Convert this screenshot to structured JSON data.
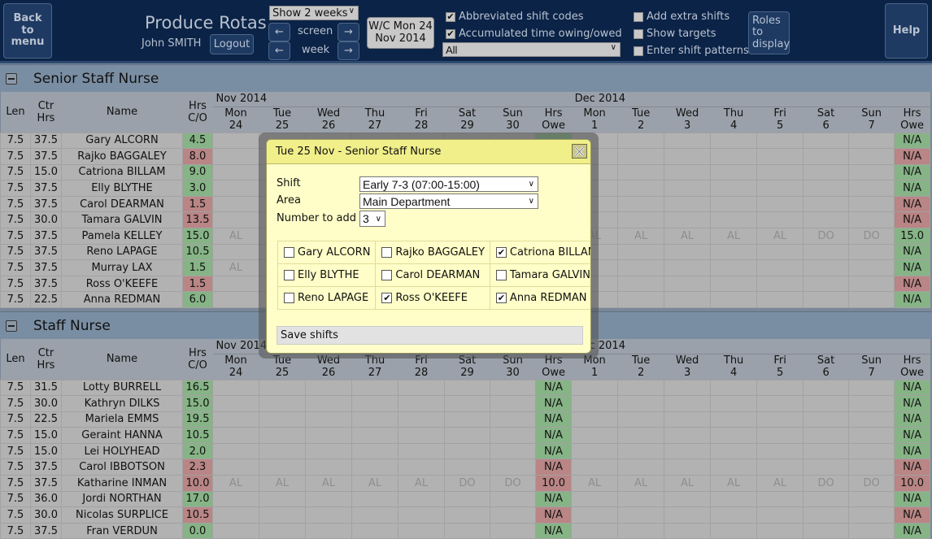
{
  "header": {
    "back_label": "Back to menu",
    "title": "Produce Rotas",
    "user": "John SMITH",
    "logout_label": "Logout",
    "show_weeks": "Show 2 weeks",
    "screen_label": "screen",
    "week_label": "week",
    "prev_arrow": "←",
    "next_arrow": "→",
    "wc_line1": "W/C Mon 24",
    "wc_line2": "Nov 2014",
    "options": [
      {
        "label": "Abbreviated shift codes",
        "checked": true
      },
      {
        "label": "Accumulated time owing/owed",
        "checked": true
      },
      {
        "label": "Add extra shifts",
        "checked": false
      },
      {
        "label": "Show targets",
        "checked": false
      },
      {
        "label": "Enter shift patterns",
        "checked": false
      }
    ],
    "filter_select": "All",
    "roles_label": "Roles to display",
    "help_label": "Help"
  },
  "columns": {
    "len": "Len",
    "ctr_hrs": "Ctr Hrs",
    "name": "Name",
    "hrs_co": "Hrs C/O",
    "month1": "Nov 2014",
    "month2": "Dec 2014",
    "days": [
      {
        "d": "Mon",
        "n": "24"
      },
      {
        "d": "Tue",
        "n": "25"
      },
      {
        "d": "Wed",
        "n": "26"
      },
      {
        "d": "Thu",
        "n": "27"
      },
      {
        "d": "Fri",
        "n": "28"
      },
      {
        "d": "Sat",
        "n": "29"
      },
      {
        "d": "Sun",
        "n": "30"
      },
      {
        "d": "Hrs",
        "n": "Owe"
      },
      {
        "d": "Mon",
        "n": "1"
      },
      {
        "d": "Tue",
        "n": "2"
      },
      {
        "d": "Wed",
        "n": "3"
      },
      {
        "d": "Thu",
        "n": "4"
      },
      {
        "d": "Fri",
        "n": "5"
      },
      {
        "d": "Sat",
        "n": "6"
      },
      {
        "d": "Sun",
        "n": "7"
      },
      {
        "d": "Hrs",
        "n": "Owe"
      }
    ]
  },
  "colors": {
    "positive": "#86b486",
    "negative": "#b98585",
    "header_bg": "#0b2347",
    "modal_bg": "#fffec8"
  },
  "sections": [
    {
      "title": "Senior Staff Nurse",
      "rows": [
        {
          "len": "7.5",
          "ctr": "37.5",
          "name": "Gary ALCORN",
          "co": "4.5",
          "co_status": "green",
          "w1": [
            "",
            "",
            "",
            "",
            "",
            "",
            ""
          ],
          "owe1": "",
          "owe1_status": "green",
          "w2": [
            "",
            "",
            "",
            "",
            "",
            "",
            ""
          ],
          "owe2": "N/A",
          "owe2_status": "green"
        },
        {
          "len": "7.5",
          "ctr": "37.5",
          "name": "Rajko BAGGALEY",
          "co": "8.0",
          "co_status": "red",
          "w1": [
            "",
            "",
            "",
            "",
            "",
            "",
            ""
          ],
          "owe1": "",
          "owe1_status": "red",
          "w2": [
            "",
            "",
            "",
            "",
            "",
            "",
            ""
          ],
          "owe2": "N/A",
          "owe2_status": "red"
        },
        {
          "len": "7.5",
          "ctr": "15.0",
          "name": "Catriona BILLAM",
          "co": "9.0",
          "co_status": "green",
          "w1": [
            "",
            "",
            "",
            "",
            "",
            "",
            ""
          ],
          "owe1": "",
          "owe1_status": "green",
          "w2": [
            "",
            "",
            "",
            "",
            "",
            "",
            ""
          ],
          "owe2": "N/A",
          "owe2_status": "green"
        },
        {
          "len": "7.5",
          "ctr": "37.5",
          "name": "Elly BLYTHE",
          "co": "3.0",
          "co_status": "green",
          "w1": [
            "",
            "",
            "",
            "",
            "",
            "",
            ""
          ],
          "owe1": "",
          "owe1_status": "green",
          "w2": [
            "",
            "",
            "",
            "",
            "",
            "",
            ""
          ],
          "owe2": "N/A",
          "owe2_status": "green"
        },
        {
          "len": "7.5",
          "ctr": "37.5",
          "name": "Carol DEARMAN",
          "co": "1.5",
          "co_status": "red",
          "w1": [
            "",
            "",
            "",
            "",
            "",
            "",
            ""
          ],
          "owe1": "",
          "owe1_status": "red",
          "w2": [
            "",
            "",
            "",
            "",
            "",
            "",
            ""
          ],
          "owe2": "N/A",
          "owe2_status": "red"
        },
        {
          "len": "7.5",
          "ctr": "30.0",
          "name": "Tamara GALVIN",
          "co": "13.5",
          "co_status": "red",
          "w1": [
            "",
            "",
            "",
            "",
            "",
            "",
            ""
          ],
          "owe1": "",
          "owe1_status": "red",
          "w2": [
            "",
            "",
            "",
            "",
            "",
            "",
            ""
          ],
          "owe2": "N/A",
          "owe2_status": "red"
        },
        {
          "len": "7.5",
          "ctr": "37.5",
          "name": "Pamela KELLEY",
          "co": "15.0",
          "co_status": "green",
          "w1": [
            "AL",
            "",
            "",
            "",
            "",
            "",
            ""
          ],
          "owe1": "",
          "owe1_status": "green",
          "w2": [
            "AL",
            "AL",
            "AL",
            "AL",
            "AL",
            "DO",
            "DO"
          ],
          "owe2": "15.0",
          "owe2_status": "green"
        },
        {
          "len": "7.5",
          "ctr": "37.5",
          "name": "Reno LAPAGE",
          "co": "10.5",
          "co_status": "green",
          "w1": [
            "",
            "",
            "",
            "",
            "",
            "",
            ""
          ],
          "owe1": "",
          "owe1_status": "green",
          "w2": [
            "",
            "",
            "",
            "",
            "",
            "",
            ""
          ],
          "owe2": "N/A",
          "owe2_status": "green"
        },
        {
          "len": "7.5",
          "ctr": "37.5",
          "name": "Murray LAX",
          "co": "1.5",
          "co_status": "green",
          "w1": [
            "AL",
            "",
            "",
            "",
            "",
            "",
            ""
          ],
          "owe1": "",
          "owe1_status": "green",
          "w2": [
            "",
            "",
            "",
            "",
            "",
            "",
            ""
          ],
          "owe2": "N/A",
          "owe2_status": "green"
        },
        {
          "len": "7.5",
          "ctr": "37.5",
          "name": "Ross O'KEEFE",
          "co": "1.5",
          "co_status": "red",
          "w1": [
            "",
            "",
            "",
            "",
            "",
            "",
            ""
          ],
          "owe1": "",
          "owe1_status": "red",
          "w2": [
            "",
            "",
            "",
            "",
            "",
            "",
            ""
          ],
          "owe2": "N/A",
          "owe2_status": "red"
        },
        {
          "len": "7.5",
          "ctr": "22.5",
          "name": "Anna REDMAN",
          "co": "6.0",
          "co_status": "green",
          "w1": [
            "",
            "",
            "",
            "",
            "",
            "",
            ""
          ],
          "owe1": "",
          "owe1_status": "green",
          "w2": [
            "",
            "",
            "",
            "",
            "",
            "",
            ""
          ],
          "owe2": "N/A",
          "owe2_status": "green"
        }
      ]
    },
    {
      "title": "Staff Nurse",
      "rows": [
        {
          "len": "7.5",
          "ctr": "31.5",
          "name": "Lotty BURRELL",
          "co": "16.5",
          "co_status": "green",
          "w1": [
            "",
            "",
            "",
            "",
            "",
            "",
            ""
          ],
          "owe1": "N/A",
          "owe1_status": "green",
          "w2": [
            "",
            "",
            "",
            "",
            "",
            "",
            ""
          ],
          "owe2": "N/A",
          "owe2_status": "green"
        },
        {
          "len": "7.5",
          "ctr": "30.0",
          "name": "Kathryn DILKS",
          "co": "15.0",
          "co_status": "green",
          "w1": [
            "",
            "",
            "",
            "",
            "",
            "",
            ""
          ],
          "owe1": "N/A",
          "owe1_status": "green",
          "w2": [
            "",
            "",
            "",
            "",
            "",
            "",
            ""
          ],
          "owe2": "N/A",
          "owe2_status": "green"
        },
        {
          "len": "7.5",
          "ctr": "22.5",
          "name": "Mariela EMMS",
          "co": "19.5",
          "co_status": "green",
          "w1": [
            "",
            "",
            "",
            "",
            "",
            "",
            ""
          ],
          "owe1": "N/A",
          "owe1_status": "green",
          "w2": [
            "",
            "",
            "",
            "",
            "",
            "",
            ""
          ],
          "owe2": "N/A",
          "owe2_status": "green"
        },
        {
          "len": "7.5",
          "ctr": "15.0",
          "name": "Geraint HANNA",
          "co": "10.5",
          "co_status": "green",
          "w1": [
            "",
            "",
            "",
            "",
            "",
            "",
            ""
          ],
          "owe1": "N/A",
          "owe1_status": "green",
          "w2": [
            "",
            "",
            "",
            "",
            "",
            "",
            ""
          ],
          "owe2": "N/A",
          "owe2_status": "green"
        },
        {
          "len": "7.5",
          "ctr": "15.0",
          "name": "Lei HOLYHEAD",
          "co": "2.0",
          "co_status": "green",
          "w1": [
            "",
            "",
            "",
            "",
            "",
            "",
            ""
          ],
          "owe1": "N/A",
          "owe1_status": "green",
          "w2": [
            "",
            "",
            "",
            "",
            "",
            "",
            ""
          ],
          "owe2": "N/A",
          "owe2_status": "green"
        },
        {
          "len": "7.5",
          "ctr": "37.5",
          "name": "Carol IBBOTSON",
          "co": "2.3",
          "co_status": "red",
          "w1": [
            "",
            "",
            "",
            "",
            "",
            "",
            ""
          ],
          "owe1": "N/A",
          "owe1_status": "red",
          "w2": [
            "",
            "",
            "",
            "",
            "",
            "",
            ""
          ],
          "owe2": "N/A",
          "owe2_status": "red"
        },
        {
          "len": "7.5",
          "ctr": "37.5",
          "name": "Katharine INMAN",
          "co": "10.0",
          "co_status": "red",
          "w1": [
            "AL",
            "AL",
            "AL",
            "AL",
            "AL",
            "DO",
            "DO"
          ],
          "owe1": "10.0",
          "owe1_status": "red",
          "w2": [
            "AL",
            "AL",
            "AL",
            "AL",
            "AL",
            "DO",
            "DO"
          ],
          "owe2": "10.0",
          "owe2_status": "red"
        },
        {
          "len": "7.5",
          "ctr": "36.0",
          "name": "Jordi NORTHAN",
          "co": "17.0",
          "co_status": "green",
          "w1": [
            "",
            "",
            "",
            "",
            "",
            "",
            ""
          ],
          "owe1": "N/A",
          "owe1_status": "green",
          "w2": [
            "",
            "",
            "",
            "",
            "",
            "",
            ""
          ],
          "owe2": "N/A",
          "owe2_status": "green"
        },
        {
          "len": "7.5",
          "ctr": "30.0",
          "name": "Nicolas SURPLICE",
          "co": "10.5",
          "co_status": "red",
          "w1": [
            "",
            "",
            "",
            "",
            "",
            "",
            ""
          ],
          "owe1": "N/A",
          "owe1_status": "red",
          "w2": [
            "",
            "",
            "",
            "",
            "",
            "",
            ""
          ],
          "owe2": "N/A",
          "owe2_status": "red"
        },
        {
          "len": "7.5",
          "ctr": "37.5",
          "name": "Fran VERDUN",
          "co": "0.0",
          "co_status": "green",
          "w1": [
            "",
            "",
            "",
            "",
            "",
            "",
            ""
          ],
          "owe1": "N/A",
          "owe1_status": "green",
          "w2": [
            "",
            "",
            "",
            "",
            "",
            "",
            ""
          ],
          "owe2": "N/A",
          "owe2_status": "green"
        }
      ]
    }
  ],
  "modal": {
    "title": "Tue 25 Nov - Senior Staff Nurse",
    "shift_label": "Shift",
    "shift_value": "Early 7-3 (07:00-15:00)",
    "area_label": "Area",
    "area_value": "Main Department",
    "number_label": "Number to add",
    "number_value": "3",
    "staff": [
      {
        "name": "Gary ALCORN",
        "checked": false
      },
      {
        "name": "Rajko BAGGALEY",
        "checked": false
      },
      {
        "name": "Catriona BILLAM",
        "checked": true
      },
      {
        "name": "Elly BLYTHE",
        "checked": false
      },
      {
        "name": "Carol DEARMAN",
        "checked": false
      },
      {
        "name": "Tamara GALVIN",
        "checked": false
      },
      {
        "name": "Reno LAPAGE",
        "checked": false
      },
      {
        "name": "Ross O'KEEFE",
        "checked": true
      },
      {
        "name": "Anna REDMAN",
        "checked": true
      }
    ],
    "save_label": "Save shifts"
  }
}
